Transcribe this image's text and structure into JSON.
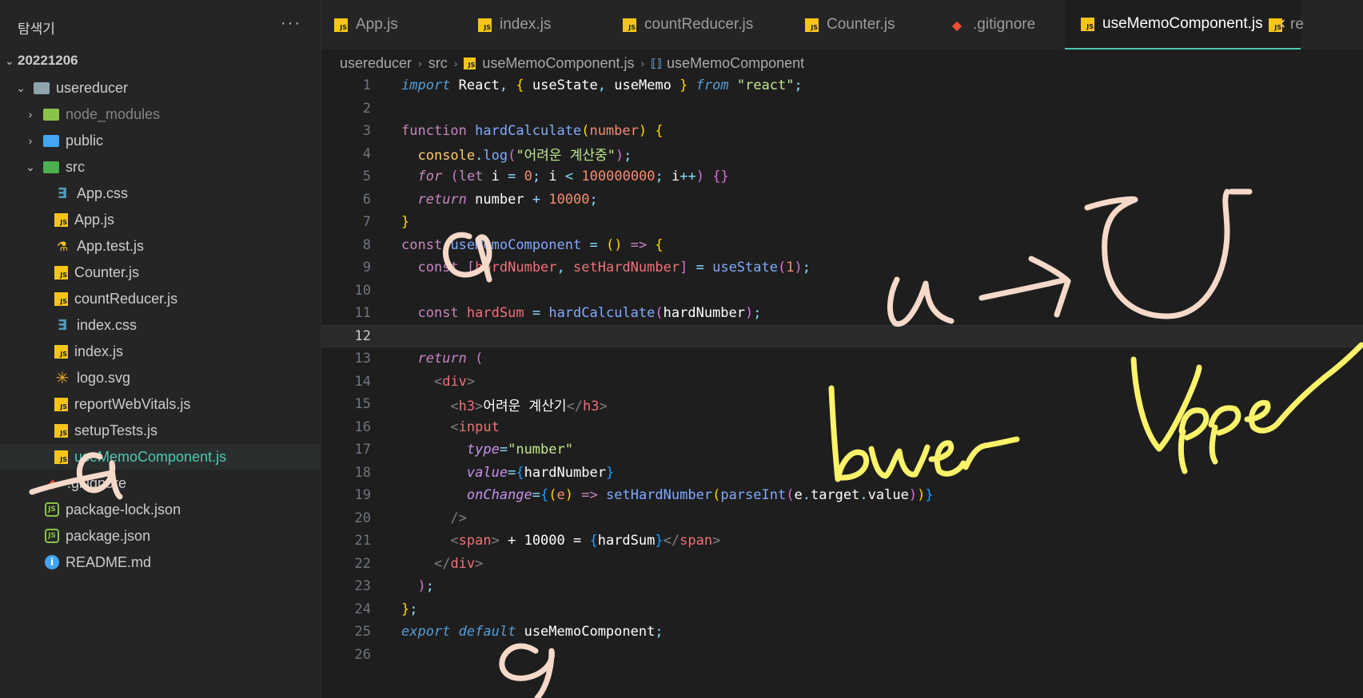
{
  "sidebar": {
    "title": "탐색기",
    "more": "···",
    "root": "20221206",
    "folder": "usereducer",
    "items": [
      {
        "label": "node_modules",
        "kind": "folder"
      },
      {
        "label": "public",
        "kind": "folder"
      },
      {
        "label": "src",
        "kind": "folder-open"
      },
      {
        "label": "App.css",
        "kind": "css"
      },
      {
        "label": "App.js",
        "kind": "js"
      },
      {
        "label": "App.test.js",
        "kind": "test"
      },
      {
        "label": "Counter.js",
        "kind": "js"
      },
      {
        "label": "countReducer.js",
        "kind": "js"
      },
      {
        "label": "index.css",
        "kind": "css"
      },
      {
        "label": "index.js",
        "kind": "js"
      },
      {
        "label": "logo.svg",
        "kind": "svg"
      },
      {
        "label": "reportWebVitals.js",
        "kind": "js"
      },
      {
        "label": "setupTests.js",
        "kind": "js"
      },
      {
        "label": "useMemoComponent.js",
        "kind": "js"
      },
      {
        "label": ".gitignore",
        "kind": "git"
      },
      {
        "label": "package-lock.json",
        "kind": "json"
      },
      {
        "label": "package.json",
        "kind": "json"
      },
      {
        "label": "README.md",
        "kind": "info"
      }
    ]
  },
  "tabs": [
    {
      "label": "App.js",
      "icon": "js-icon"
    },
    {
      "label": "index.js",
      "icon": "js-icon"
    },
    {
      "label": "countReducer.js",
      "icon": "js-icon"
    },
    {
      "label": "Counter.js",
      "icon": "js-icon"
    },
    {
      "label": ".gitignore",
      "icon": "git-icon"
    },
    {
      "label": "useMemoComponent.js",
      "icon": "js-icon",
      "active": true
    },
    {
      "label": "re",
      "icon": "js-icon"
    }
  ],
  "tab_close": "×",
  "breadcrumb": {
    "parts": [
      "usereducer",
      "src",
      "useMemoComponent.js",
      "useMemoComponent"
    ]
  },
  "editor": {
    "line_numbers": [
      "1",
      "2",
      "3",
      "4",
      "5",
      "6",
      "7",
      "8",
      "9",
      "10",
      "11",
      "12",
      "13",
      "14",
      "15",
      "16",
      "17",
      "18",
      "19",
      "20",
      "21",
      "22",
      "23",
      "24",
      "25",
      "26"
    ],
    "current_line": 12
  },
  "annotations": {
    "handwriting": [
      "u → U",
      "lower",
      "Upper"
    ]
  },
  "colors": {
    "accent": "#4ec9b0",
    "ink_pink": "#f6d9c9",
    "ink_yellow": "#fbf36a"
  }
}
